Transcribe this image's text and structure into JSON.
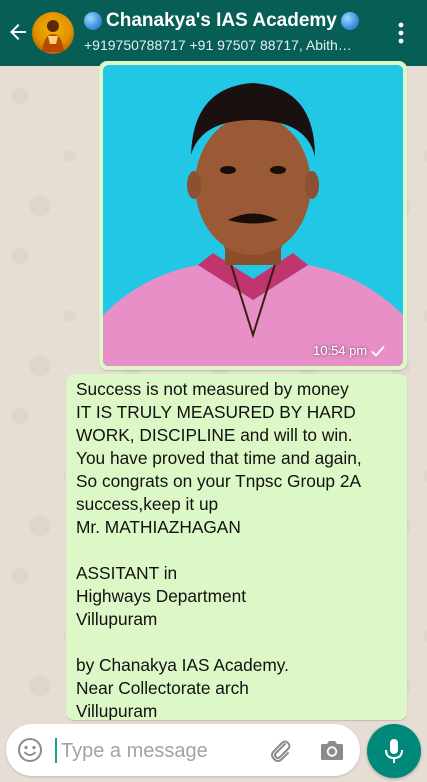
{
  "header": {
    "title": "Chanakya's IAS Academy",
    "subtitle": "+919750788717 +91 97507 88717, Abith…"
  },
  "messages": [
    {
      "type": "image",
      "time": "10:54 pm"
    },
    {
      "type": "text",
      "lines": [
        "Success is not measured by money",
        "IT IS TRULY MEASURED BY HARD",
        "WORK, DISCIPLINE and will to win.",
        "You have proved that time and again,",
        "So congrats on your Tnpsc Group 2A",
        "success,keep it up",
        "Mr. MATHIAZHAGAN",
        "",
        "ASSITANT in",
        "Highways Department",
        "Villupuram",
        "",
        "by Chanakya IAS Academy.",
        "Near Collectorate arch",
        "Villupuram"
      ]
    }
  ],
  "composer": {
    "placeholder": "Type a message",
    "value": ""
  },
  "colors": {
    "header": "#075e54",
    "bubble_out": "#dcf8c6",
    "mic_button": "#00897b"
  },
  "icons": [
    "back-arrow-icon",
    "globe-icon",
    "more-vert-icon",
    "read-check-icon",
    "emoji-icon",
    "attach-icon",
    "camera-icon",
    "mic-icon"
  ]
}
